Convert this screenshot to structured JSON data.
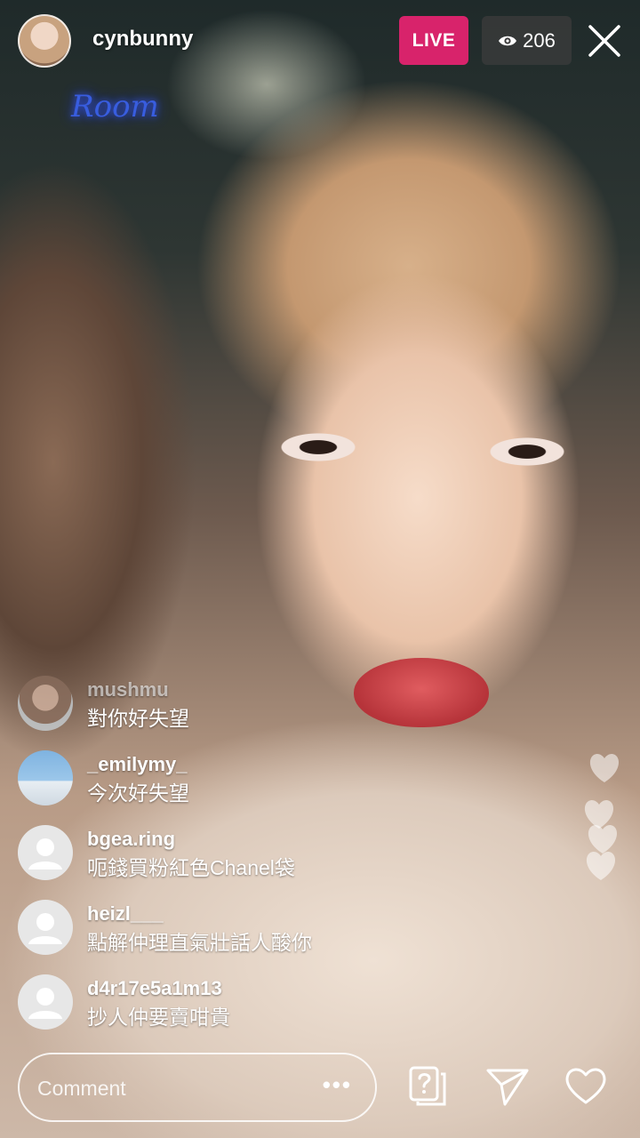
{
  "host": {
    "username": "cynbunny"
  },
  "status": {
    "live_label": "LIVE",
    "viewer_count": "206"
  },
  "background": {
    "neon_sign": "Room"
  },
  "comments": [
    {
      "user": "mushmu",
      "message": "對你好失望",
      "avatar": "photo",
      "faded": true
    },
    {
      "user": "_emilymy_",
      "message": "今次好失望",
      "avatar": "photo"
    },
    {
      "user": "bgea.ring",
      "message": "呃錢買粉紅色Chanel袋",
      "avatar": "default"
    },
    {
      "user": "heizl___",
      "message": "點解仲理直氣壯話人酸你",
      "avatar": "default"
    },
    {
      "user": "d4r17e5a1m13",
      "message": "抄人仲要賣咁貴",
      "avatar": "default"
    }
  ],
  "footer": {
    "comment_placeholder": "Comment",
    "more_label": "•••",
    "icons": [
      "question-card-icon",
      "send-icon",
      "heart-icon"
    ]
  },
  "colors": {
    "live": "#d8236b",
    "viewer_pill": "#3c3c3c",
    "text": "#ffffff"
  }
}
